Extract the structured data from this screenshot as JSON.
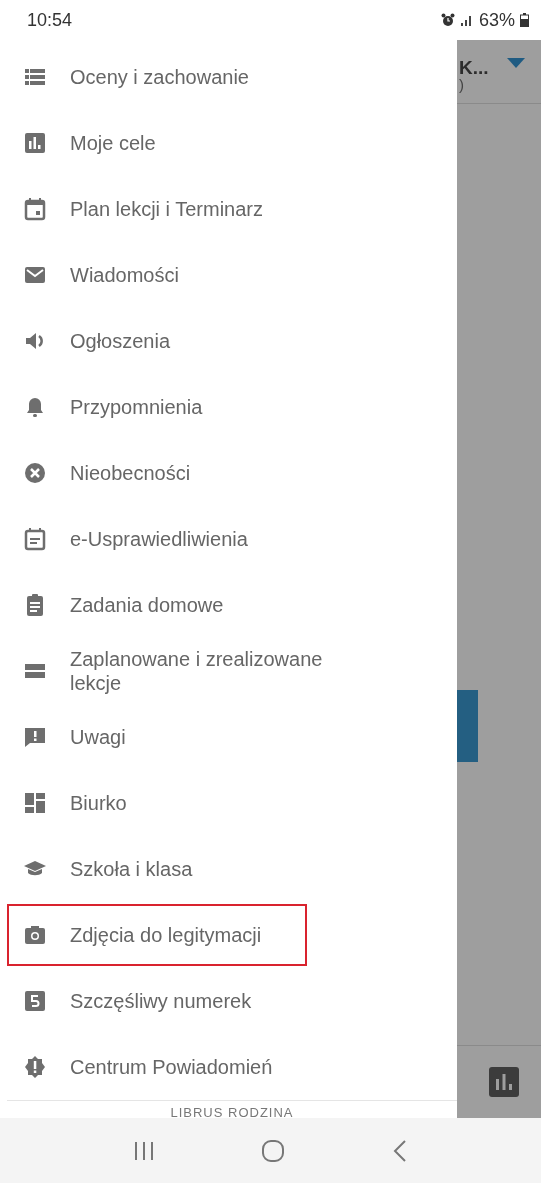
{
  "status_bar": {
    "time": "10:54",
    "battery": "63%"
  },
  "background_screen": {
    "title": "K...",
    "subtitle": ")"
  },
  "drawer": {
    "items": [
      {
        "label": "Oceny i zachowanie",
        "selected": false
      },
      {
        "label": "Moje cele",
        "selected": false
      },
      {
        "label": "Plan lekcji i Terminarz",
        "selected": false
      },
      {
        "label": "Wiadomości",
        "selected": false
      },
      {
        "label": "Ogłoszenia",
        "selected": false
      },
      {
        "label": "Przypomnienia",
        "selected": false
      },
      {
        "label": "Nieobecności",
        "selected": false
      },
      {
        "label": "e-Usprawiedliwienia",
        "selected": false
      },
      {
        "label": "Zadania domowe",
        "selected": false
      },
      {
        "label": "Zaplanowane i zrealizowane lekcje",
        "selected": false
      },
      {
        "label": "Uwagi",
        "selected": false
      },
      {
        "label": "Biurko",
        "selected": false
      },
      {
        "label": "Szkoła i klasa",
        "selected": false
      },
      {
        "label": "Zdjęcia do legitymacji",
        "selected": true
      },
      {
        "label": "Szczęśliwy numerek",
        "selected": false
      },
      {
        "label": "Centrum Powiadomień",
        "selected": false
      }
    ],
    "footer": "LIBRUS RODZINA"
  }
}
